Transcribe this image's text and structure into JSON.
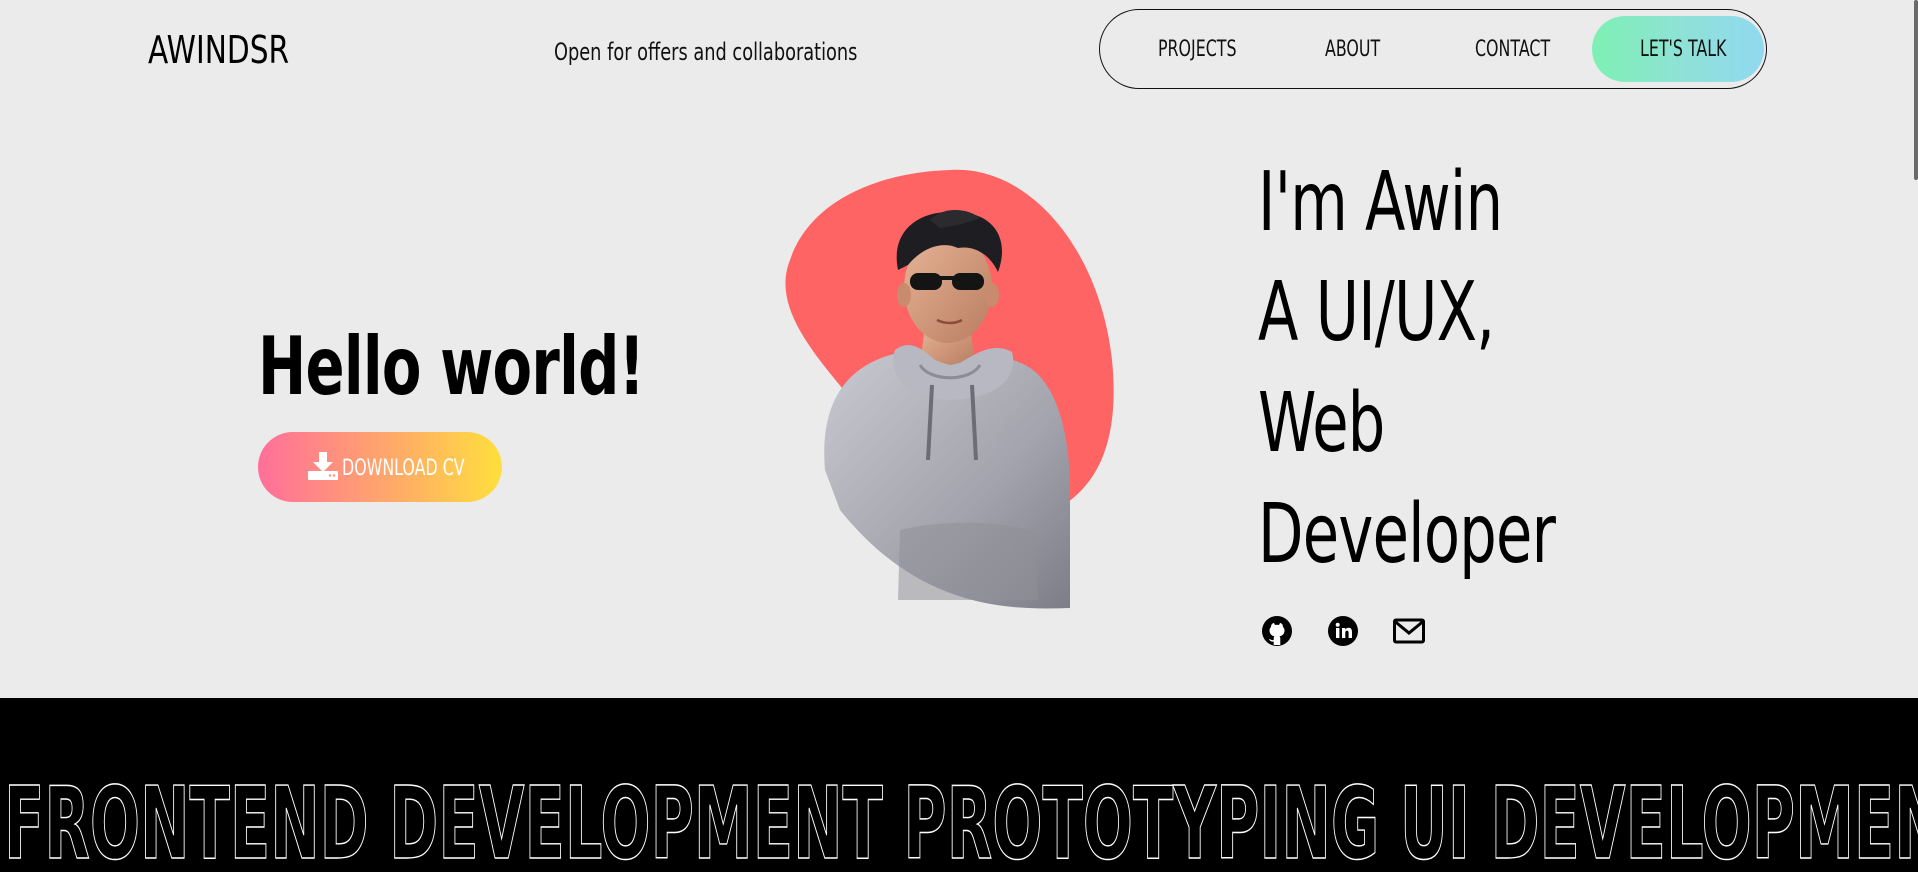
{
  "header": {
    "logo": "AWINDSR",
    "tagline": "Open for offers and collaborations",
    "nav": [
      {
        "label": "PROJECTS"
      },
      {
        "label": "ABOUT"
      },
      {
        "label": "CONTACT"
      }
    ],
    "cta_label": "LET'S TALK"
  },
  "hero": {
    "greeting": "Hello world!",
    "download_label": "DOWNLOAD CV",
    "intro_lines": [
      "I'm Awin",
      "A UI/UX,",
      "Web",
      "Developer"
    ],
    "avatar_icon": "3d-avatar-illustration",
    "social": [
      {
        "icon": "github-icon"
      },
      {
        "icon": "linkedin-icon"
      },
      {
        "icon": "mail-icon"
      }
    ]
  },
  "marquee": {
    "text": "FRONTEND DEVELOPMENT PROTOTYPING UI DEVELOPMENT"
  },
  "colors": {
    "background": "#ebebeb",
    "blob": "#ff6464",
    "cta_gradient_start": "#7ef0b4",
    "cta_gradient_end": "#90d9f0",
    "download_gradient_start": "#ff6f9a",
    "download_gradient_end": "#ffdf3d",
    "band": "#000000"
  }
}
